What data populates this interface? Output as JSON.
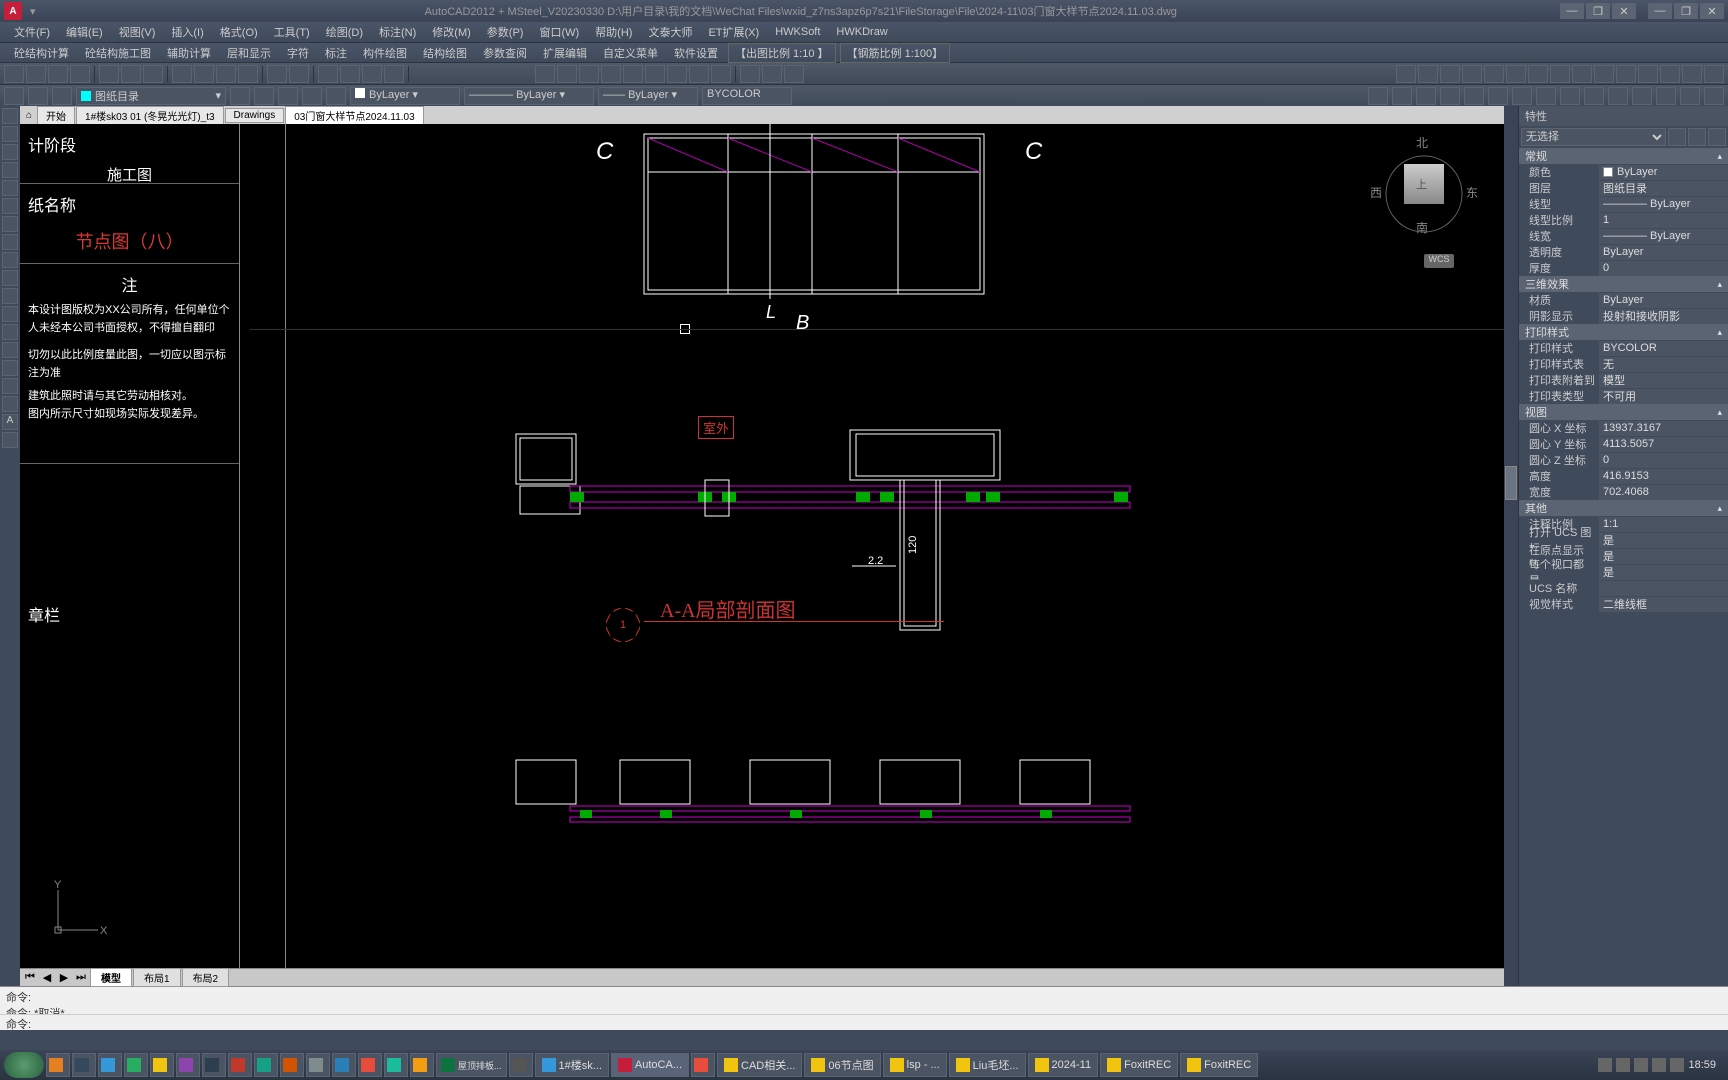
{
  "app": {
    "title": "AutoCAD2012 + MSteel_V20230330    D:\\用户目录\\我的文档\\WeChat Files\\wxid_z7ns3apz6p7s21\\FileStorage\\File\\2024-11\\03门窗大样节点2024.11.03.dwg",
    "logo_letter": "A"
  },
  "window_controls": {
    "min": "—",
    "max": "❐",
    "close": "✕"
  },
  "menu": [
    "文件(F)",
    "编辑(E)",
    "视图(V)",
    "插入(I)",
    "格式(O)",
    "工具(T)",
    "绘图(D)",
    "标注(N)",
    "修改(M)",
    "参数(P)",
    "窗口(W)",
    "帮助(H)",
    "文泰大师",
    "ET扩展(X)",
    "HWKSoft",
    "HWKDraw"
  ],
  "menu2": {
    "items": [
      "砼结构计算",
      "砼结构施工图",
      "辅助计算",
      "层和显示",
      "字符",
      "标注",
      "构件绘图",
      "结构绘图",
      "参数查阅",
      "扩展编辑",
      "自定义菜单",
      "软件设置"
    ],
    "scale1": "【出图比例  1:10  】",
    "scale2": "【钢筋比例  1:100】"
  },
  "layer": {
    "current": "图纸目录",
    "linetype_combo": "ByLayer",
    "lineweight_combo": "ByLayer",
    "linetype2": "ByLayer",
    "color_combo": "BYCOLOR"
  },
  "doc_tabs": {
    "tabs": [
      "开始",
      "1#楼sk03 01 (冬晃光光灯)_t3",
      "Drawings",
      "03门窗大样节点2024.11.03"
    ],
    "active": 3
  },
  "layout_tabs": {
    "tabs": [
      "模型",
      "布局1",
      "布局2"
    ],
    "active": 0
  },
  "properties": {
    "title": "特性",
    "selection": "无选择",
    "sections": {
      "general": {
        "title": "常规",
        "rows": [
          {
            "label": "颜色",
            "value": "ByLayer",
            "swatch": "#fff"
          },
          {
            "label": "图层",
            "value": "图纸目录"
          },
          {
            "label": "线型",
            "value": "———— ByLayer"
          },
          {
            "label": "线型比例",
            "value": "1"
          },
          {
            "label": "线宽",
            "value": "———— ByLayer"
          },
          {
            "label": "透明度",
            "value": "ByLayer"
          },
          {
            "label": "厚度",
            "value": "0"
          }
        ]
      },
      "threed": {
        "title": "三维效果",
        "rows": [
          {
            "label": "材质",
            "value": "ByLayer"
          },
          {
            "label": "阴影显示",
            "value": "投射和接收阴影"
          }
        ]
      },
      "plotstyle": {
        "title": "打印样式",
        "rows": [
          {
            "label": "打印样式",
            "value": "BYCOLOR"
          },
          {
            "label": "打印样式表",
            "value": "无"
          },
          {
            "label": "打印表附着到",
            "value": "模型"
          },
          {
            "label": "打印表类型",
            "value": "不可用"
          }
        ]
      },
      "view": {
        "title": "视图",
        "rows": [
          {
            "label": "圆心 X 坐标",
            "value": "13937.3167"
          },
          {
            "label": "圆心 Y 坐标",
            "value": "4113.5057"
          },
          {
            "label": "圆心 Z 坐标",
            "value": "0"
          },
          {
            "label": "高度",
            "value": "416.9153"
          },
          {
            "label": "宽度",
            "value": "702.4068"
          }
        ]
      },
      "misc": {
        "title": "其他",
        "rows": [
          {
            "label": "注释比例",
            "value": "1:1"
          },
          {
            "label": "打开 UCS 图标",
            "value": "是"
          },
          {
            "label": "在原点显示 U...",
            "value": "是"
          },
          {
            "label": "每个视口都是...",
            "value": "是"
          },
          {
            "label": "UCS 名称",
            "value": ""
          },
          {
            "label": "视觉样式",
            "value": "二维线框"
          }
        ]
      }
    }
  },
  "canvas": {
    "title_block": {
      "stage_label": "计阶段",
      "stage_value": "施工图",
      "name_label": "纸名称",
      "name_value": "节点图（八）",
      "note_label": "注",
      "notes": [
        "本设计图版权为XX公司所有，任何单位个人未经本公司书面授权，不得擅自翻印",
        "切勿以此比例度量此图，一切应以图示标注为准",
        "建筑此照时请与其它劳动相核对。",
        "图内所示尺寸如现场实际发现差异。"
      ],
      "seal_label": "章栏"
    },
    "markers": {
      "C1": "C",
      "C2": "C",
      "L": "L",
      "B": "B"
    },
    "section": {
      "label": "A-A局部剖面图",
      "num": "1"
    },
    "outdoor": "室外",
    "dim": {
      "d1": "120",
      "d2": "2.2"
    },
    "viewcube": {
      "n": "北",
      "s": "南",
      "e": "东",
      "w": "西",
      "top": "上",
      "wcs": "WCS"
    },
    "ucs": {
      "x": "X",
      "y": "Y"
    }
  },
  "cmdline": {
    "hist1": "命令:",
    "hist2": "命令: *取消*",
    "prompt": "命令:"
  },
  "taskbar": {
    "items": [
      "1#楼sk...",
      "AutoCA...",
      "",
      "CAD相关...",
      "06节点图",
      "lsp - ...",
      "Liu毛坯...",
      "2024-11",
      "FoxitREC",
      "FoxitREC"
    ],
    "time": "18:59"
  }
}
